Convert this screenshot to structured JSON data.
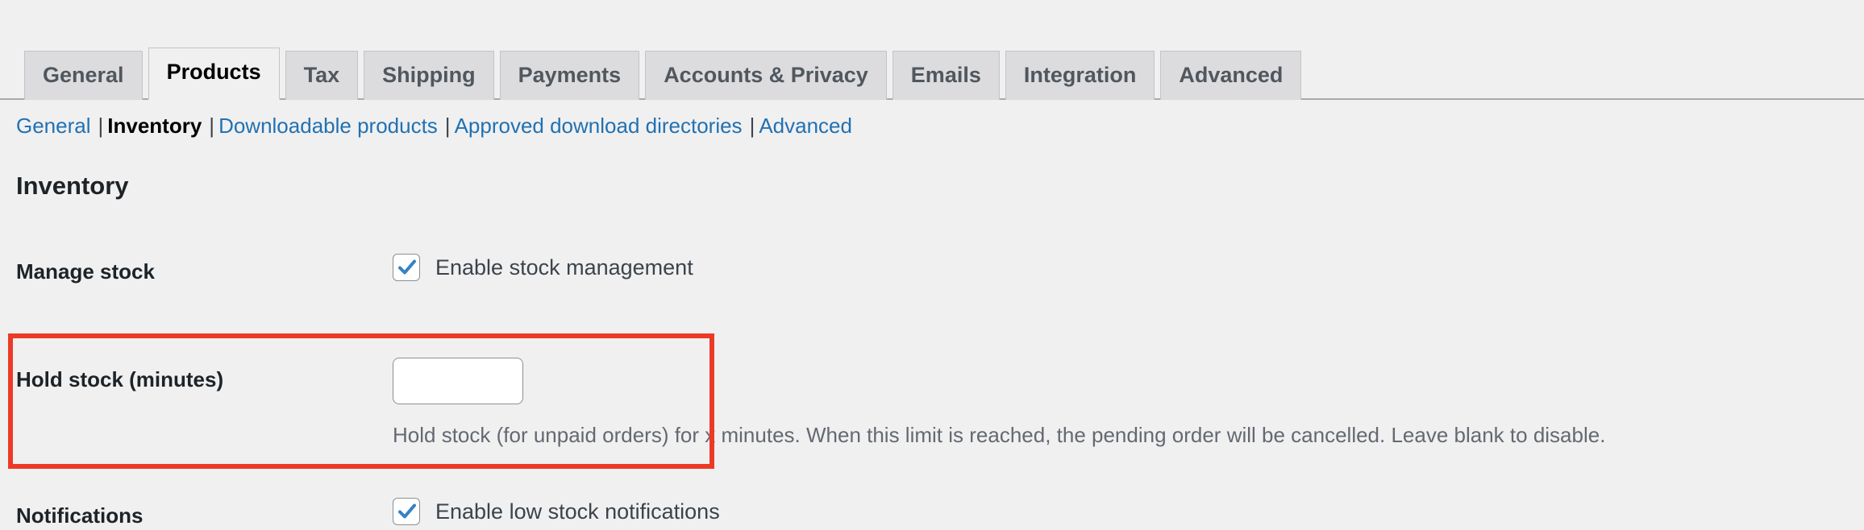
{
  "tabs": {
    "items": [
      {
        "label": "General",
        "active": false
      },
      {
        "label": "Products",
        "active": true
      },
      {
        "label": "Tax",
        "active": false
      },
      {
        "label": "Shipping",
        "active": false
      },
      {
        "label": "Payments",
        "active": false
      },
      {
        "label": "Accounts & Privacy",
        "active": false
      },
      {
        "label": "Emails",
        "active": false
      },
      {
        "label": "Integration",
        "active": false
      },
      {
        "label": "Advanced",
        "active": false
      }
    ]
  },
  "subnav": {
    "items": [
      {
        "label": "General",
        "current": false
      },
      {
        "label": "Inventory",
        "current": true
      },
      {
        "label": "Downloadable products",
        "current": false
      },
      {
        "label": "Approved download directories",
        "current": false
      },
      {
        "label": "Advanced",
        "current": false
      }
    ],
    "separator": "|"
  },
  "section": {
    "title": "Inventory"
  },
  "fields": {
    "manage_stock": {
      "label": "Manage stock",
      "checkbox_label": "Enable stock management",
      "checked": true
    },
    "hold_stock": {
      "label": "Hold stock (minutes)",
      "value": "",
      "placeholder": "",
      "description": "Hold stock (for unpaid orders) for x minutes. When this limit is reached, the pending order will be cancelled. Leave blank to disable."
    },
    "notifications": {
      "label": "Notifications",
      "checkbox_label": "Enable low stock notifications",
      "checked": true
    }
  },
  "annotation": {
    "color": "#ec3a26",
    "target": "hold-stock-row"
  },
  "colors": {
    "page_background": "#f0f0f1",
    "tab_inactive_background": "#dcdcde",
    "tab_active_background": "#f0f0f1",
    "link": "#2271b1",
    "text_primary": "#1d2327",
    "text_muted": "#646970",
    "checkbox_check": "#3582c4",
    "border": "#8c8f94",
    "annotation": "#ec3a26"
  }
}
